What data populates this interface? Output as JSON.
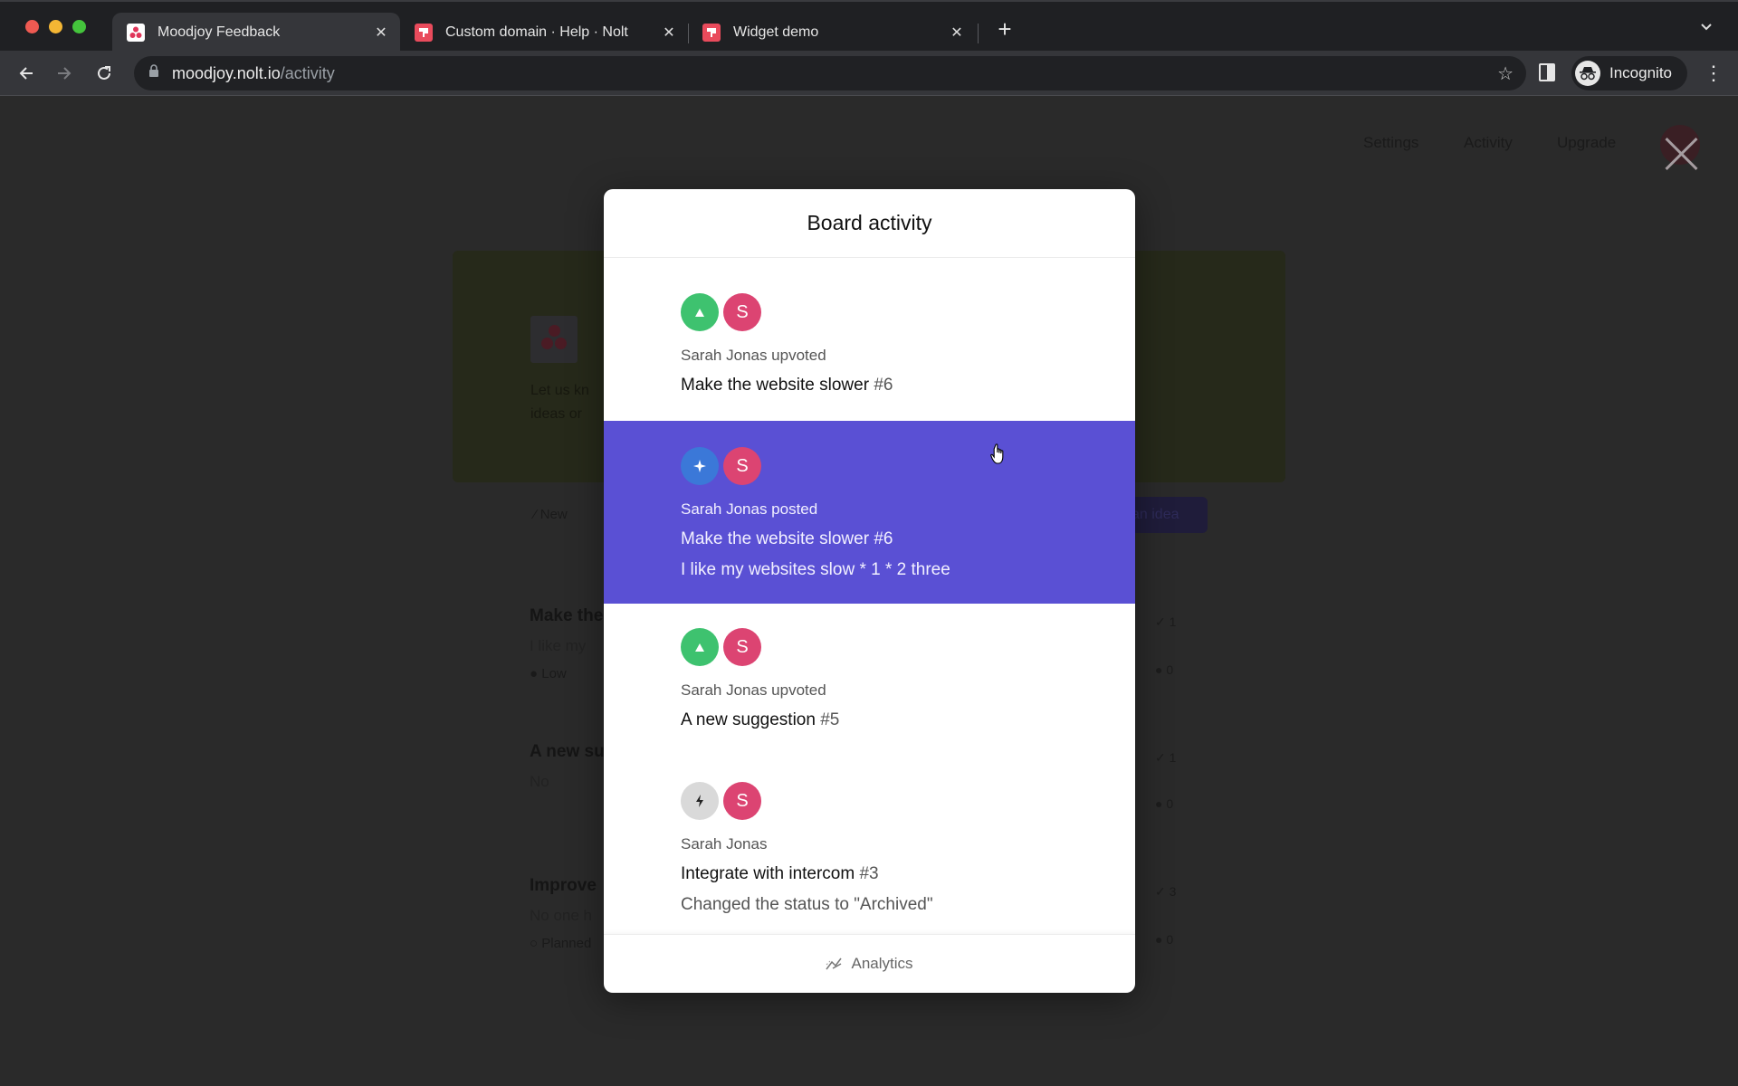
{
  "browser": {
    "tabs": [
      {
        "title": "Moodjoy Feedback",
        "favicon": "moodjoy-logo",
        "active": true
      },
      {
        "title": "Custom domain · Help · Nolt",
        "favicon": "nolt-logo",
        "active": false
      },
      {
        "title": "Widget demo",
        "favicon": "nolt-logo",
        "active": false
      }
    ],
    "url_host": "moodjoy.nolt.io",
    "url_path": "/activity",
    "profile_label": "Incognito"
  },
  "page": {
    "nav": [
      "Settings",
      "Activity",
      "Upgrade"
    ],
    "hero_text": [
      "Let us kn",
      "ideas or"
    ],
    "filter_label": "New",
    "new_idea_label": "an idea",
    "background_posts": [
      {
        "title": "Make the",
        "subtitle": "I like my",
        "tag": "Low",
        "votes": "1",
        "comments": "0"
      },
      {
        "title": "A new su",
        "subtitle": "No",
        "tag": "",
        "votes": "1",
        "comments": "0"
      },
      {
        "title": "Improve",
        "subtitle": "No one h",
        "tag": "Planned",
        "votes": "3",
        "comments": "0"
      }
    ]
  },
  "modal": {
    "title": "Board activity",
    "activities": [
      {
        "type_icon": "upvote-icon",
        "avatar_initial": "S",
        "actor_line": "Sarah Jonas upvoted",
        "post_title": "Make the website slower",
        "post_number": "#6",
        "detail": "",
        "hovered": false
      },
      {
        "type_icon": "sparkle-icon",
        "avatar_initial": "S",
        "actor_line": "Sarah Jonas posted",
        "post_title": "Make the website slower",
        "post_number": "#6",
        "detail": "I like my websites slow * 1 * 2 three",
        "hovered": true
      },
      {
        "type_icon": "upvote-icon",
        "avatar_initial": "S",
        "actor_line": "Sarah Jonas upvoted",
        "post_title": "A new suggestion",
        "post_number": "#5",
        "detail": "",
        "hovered": false
      },
      {
        "type_icon": "bolt-icon",
        "avatar_initial": "S",
        "actor_line": "Sarah Jonas",
        "post_title": "Integrate with intercom",
        "post_number": "#3",
        "detail": "Changed the status to \"Archived\"",
        "hovered": false
      }
    ],
    "footer_label": "Analytics"
  },
  "colors": {
    "hover_accent": "#5a50d4",
    "upvote_green": "#3ec26f",
    "post_blue": "#3b78d8",
    "avatar_pink": "#dc4472",
    "status_grey": "#d9d9d9"
  }
}
